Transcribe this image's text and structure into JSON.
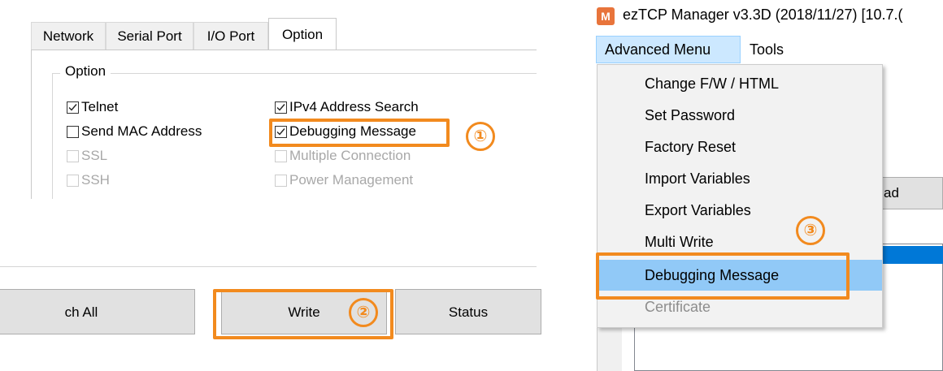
{
  "options_panel": {
    "tabs": [
      {
        "label": "Network"
      },
      {
        "label": "Serial Port"
      },
      {
        "label": "I/O Port"
      },
      {
        "label": "Option"
      }
    ],
    "group_title": "Option",
    "checkboxes": {
      "telnet": {
        "label": "Telnet",
        "checked": true
      },
      "send_mac": {
        "label": "Send MAC Address",
        "checked": false
      },
      "ssl": {
        "label": "SSL",
        "checked": false
      },
      "ssh": {
        "label": "SSH",
        "checked": false
      },
      "ipv4_search": {
        "label": "IPv4 Address Search",
        "checked": true
      },
      "debugging": {
        "label": "Debugging Message",
        "checked": true
      },
      "multiple_conn": {
        "label": "Multiple Connection",
        "checked": false
      },
      "power_mgmt": {
        "label": "Power Management",
        "checked": false
      }
    },
    "step_marker": "①"
  },
  "buttons_panel": {
    "search_all_label": "ch All",
    "write_label": "Write",
    "status_label": "Status",
    "step_marker": "②"
  },
  "manager_panel": {
    "title": "ezTCP Manager v3.3D (2018/11/27) [10.7.(",
    "app_icon_letter": "M",
    "menu_bar": {
      "advanced": "Advanced Menu",
      "tools": "Tools"
    },
    "dropdown_items": [
      {
        "label": "Change F/W / HTML"
      },
      {
        "label": "Set Password"
      },
      {
        "label": "Factory Reset"
      },
      {
        "label": "Import Variables"
      },
      {
        "label": "Export Variables"
      },
      {
        "label": "Multi Write"
      },
      {
        "label": "Debugging Message"
      },
      {
        "label": "Certificate"
      }
    ],
    "background_button_label": "ad",
    "step_marker": "③"
  },
  "colors": {
    "highlight": "#f28a1e",
    "menu_hover": "#91c9f7",
    "menu_open": "#cce8ff"
  }
}
